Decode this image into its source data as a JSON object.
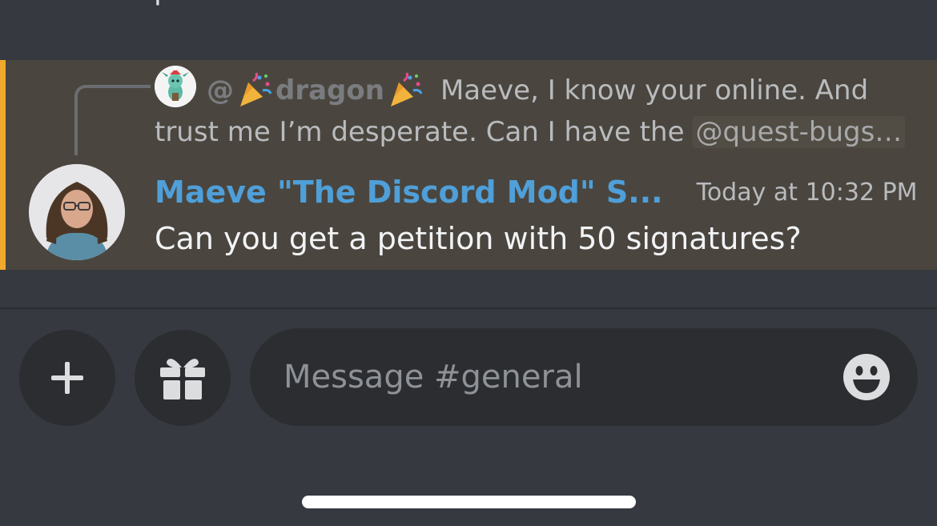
{
  "previous_message": {
    "text": "pls"
  },
  "reply": {
    "mention_prefix": "@",
    "username": "dragon",
    "text_line1": "Maeve, I know your online. And",
    "text_line2": "trust me I’m desperate. Can I have the",
    "role_mention": "@quest-bugs…",
    "party_icon": "party-popper-emoji"
  },
  "message": {
    "author": "Maeve \"The Discord Mod\" S...",
    "timestamp": "Today at 10:32 PM",
    "text": "Can you get a petition with 50 signatures?",
    "author_color": "#4f9fd9",
    "highlight_accent": "#f0a92e"
  },
  "composer": {
    "placeholder": "Message #general",
    "attach_icon": "plus-icon",
    "gift_icon": "gift-icon",
    "emoji_icon": "smiley-icon"
  }
}
